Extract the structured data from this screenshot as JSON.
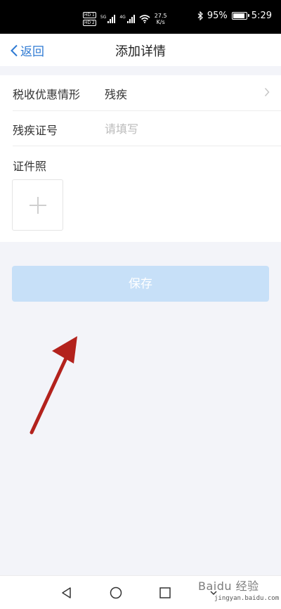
{
  "statusbar": {
    "hd1": "HD 1",
    "hd2": "HD 2",
    "net1": "5G",
    "net2": "4G",
    "speed_value": "27.5",
    "speed_unit": "K/s",
    "battery_percent": "95%",
    "battery_level": 0.95,
    "time": "5:29",
    "icons": [
      "bluetooth-icon",
      "wifi-icon",
      "battery-icon",
      "signal-icon"
    ]
  },
  "header": {
    "back_label": "返回",
    "title": "添加详情"
  },
  "form": {
    "rows": [
      {
        "label": "税收优惠情形",
        "value": "残疾"
      },
      {
        "label": "残疾证号",
        "value": "",
        "placeholder": "请填写"
      }
    ],
    "photo_label": "证件照"
  },
  "save_label": "保存",
  "watermark": {
    "text": "Baidu 经验",
    "sub": "jingyan.baidu.com"
  },
  "colors": {
    "accent": "#2e7ad3",
    "save_bg": "#c7e0f8",
    "arrow": "#b3221d",
    "page_bg": "#f3f4f9"
  }
}
